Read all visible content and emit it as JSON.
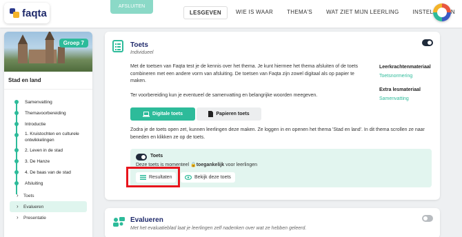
{
  "brand": {
    "name": "faqta"
  },
  "topbar": {
    "action_label": "AFSLUITEN",
    "nav": [
      "LESGEVEN",
      "WIE IS WAAR",
      "THEMA'S",
      "WAT ZIET MIJN LEERLING",
      "INSTELLINGEN"
    ],
    "active_nav": "LESGEVEN"
  },
  "sidebar": {
    "badge": "Groep 7",
    "theme_title": "Stad en land",
    "items": [
      {
        "label": "Samenvatting"
      },
      {
        "label": "Themavoorbereiding"
      },
      {
        "label": "Introductie"
      },
      {
        "label": "1. Kruistochten en culturele ontwikkelingen"
      },
      {
        "label": "2. Leven in de stad"
      },
      {
        "label": "3. De Hanze"
      },
      {
        "label": "4. De baas van de stad"
      },
      {
        "label": "Afsluiting"
      }
    ],
    "subitems": [
      {
        "label": "Toets",
        "active": false
      },
      {
        "label": "Evalueren",
        "active": true
      },
      {
        "label": "Presentatie",
        "active": false
      }
    ]
  },
  "toets_card": {
    "title": "Toets",
    "subtitle": "Individueel",
    "toggle_on": true,
    "paragraph1": "Met de toetsen van Faqta test je de kennis over het thema. Je kunt hiermee het thema afsluiten of de toets combineren met een andere vorm van afsluiting. De toetsen van Faqta zijn zowel digitaal als op papier te maken.",
    "paragraph2": "Ter voorbereiding kun je eventueel de samenvatting en belangrijke woorden meegeven.",
    "tabs": [
      "Digitale toets",
      "Papieren toets"
    ],
    "paragraph3": "Zodra je de toets open zet, kunnen leerlingen deze maken. Ze loggen in en openen het thema 'Stad en land'. In dit thema scrollen ze naar beneden en klikken ze op de toets.",
    "right": {
      "heading1": "Leerkrachtenmateriaal",
      "link1": "Toetsnormering",
      "heading2": "Extra lesmateriaal",
      "link2": "Samenvatting"
    },
    "panel": {
      "title": "Toets",
      "status_prefix": "Deze toets is momenteel",
      "status_bold": "toegankelijk",
      "status_suffix": "voor leerlingen",
      "results_button": "Resultaten",
      "view_button": "Bekijk deze toets"
    }
  },
  "evalueren_card": {
    "title": "Evalueren",
    "subtitle": "Met het evaluatieblad laat je leerlingen zelf nadenken over wat ze hebben geleerd.",
    "toggle_on": false
  },
  "colors": {
    "accent": "#2dbb9a",
    "navy": "#1f2a6b",
    "highlight": "#e8141c"
  }
}
